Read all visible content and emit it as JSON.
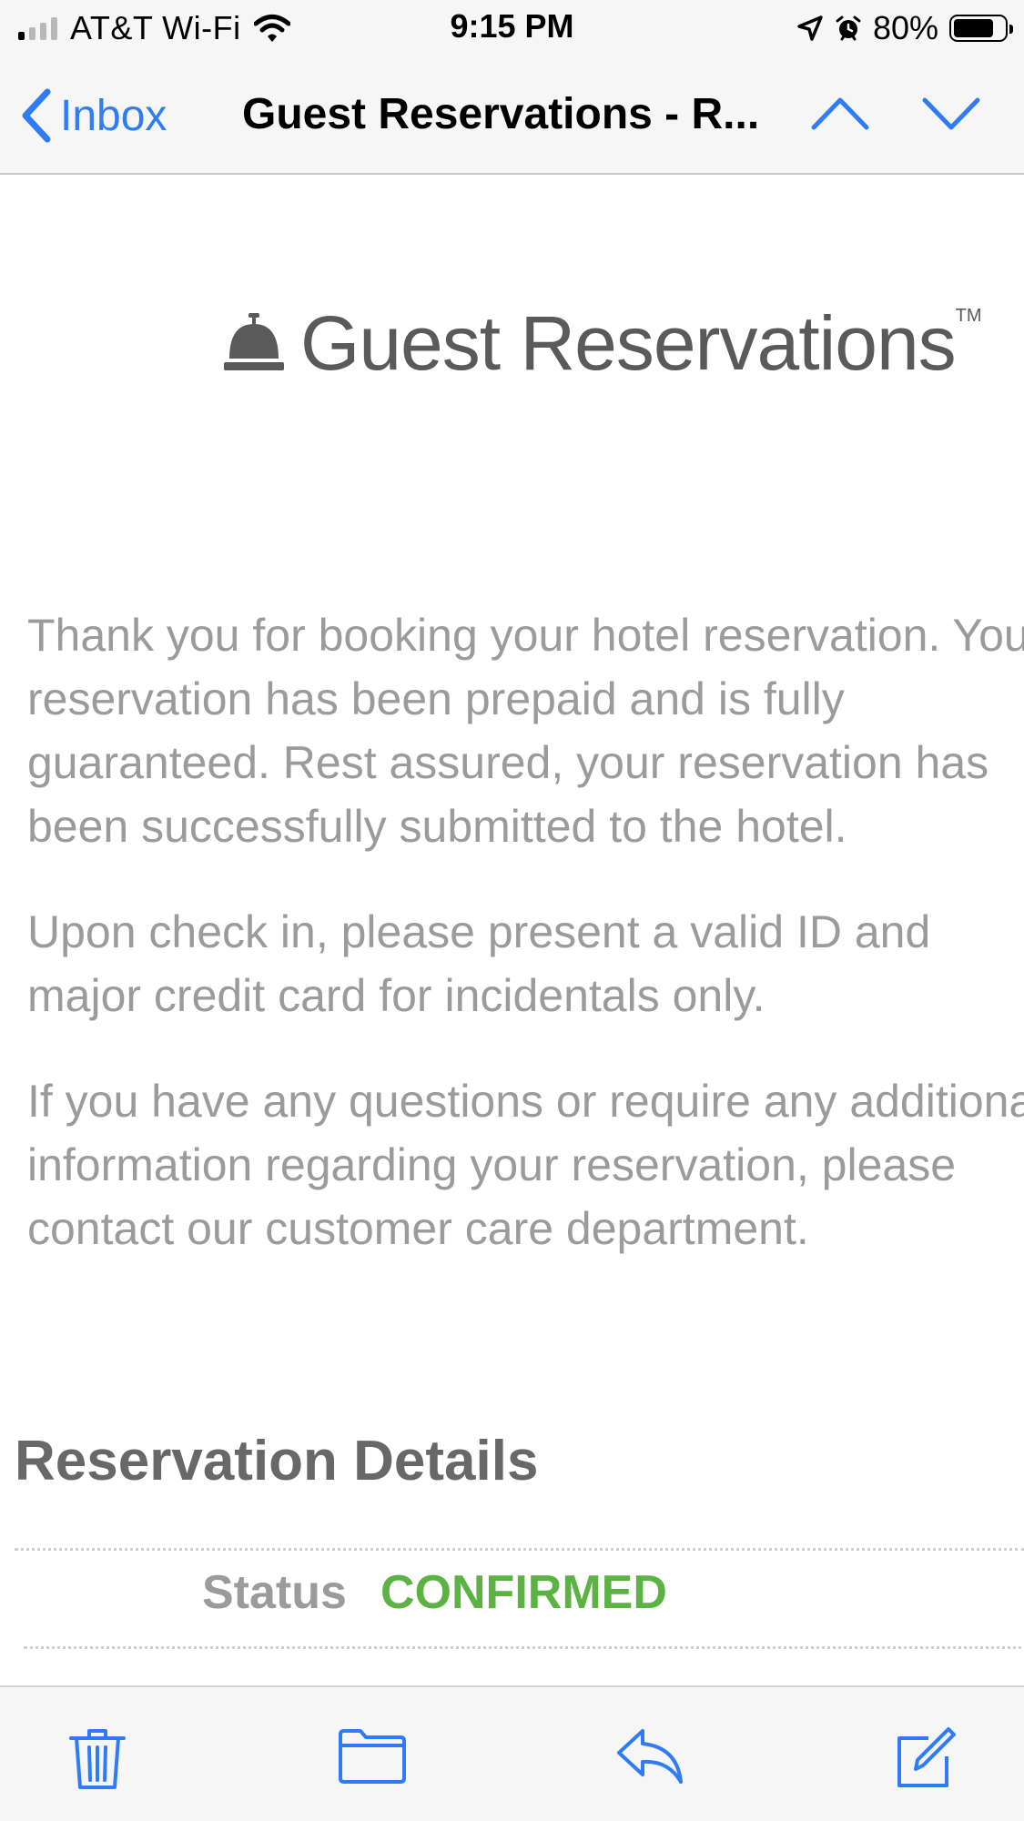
{
  "status_bar": {
    "carrier": "AT&T Wi-Fi",
    "time": "9:15 PM",
    "battery_percent": "80%",
    "battery_level": 0.8,
    "signal_bars_active": 1,
    "icons": [
      "wifi-icon",
      "location-arrow-icon",
      "alarm-icon",
      "battery-icon"
    ]
  },
  "nav": {
    "back_label": "Inbox",
    "title": "Guest Reservations - R...",
    "prev_icon": "chevron-up-icon",
    "next_icon": "chevron-down-icon",
    "accent_color": "#2f7cf6"
  },
  "email": {
    "logo_text": "Guest Reservations",
    "logo_tm": "TM",
    "paragraphs": [
      [
        "Thank you for booking your hotel reservation. Your",
        "reservation has been prepaid and is fully",
        "guaranteed. Rest assured, your reservation has",
        "been successfully submitted to the hotel."
      ],
      [
        "Upon check in, please present a valid ID and",
        "major credit card for incidentals only."
      ],
      [
        "If you have any questions or require any additional",
        "information regarding your reservation, please",
        "contact our customer care department."
      ]
    ],
    "details_heading": "Reservation Details",
    "status_label": "Status",
    "status_value": "CONFIRMED",
    "status_color": "#5cb343"
  },
  "toolbar": {
    "icons": [
      "trash-icon",
      "folder-icon",
      "reply-icon",
      "compose-icon"
    ]
  }
}
